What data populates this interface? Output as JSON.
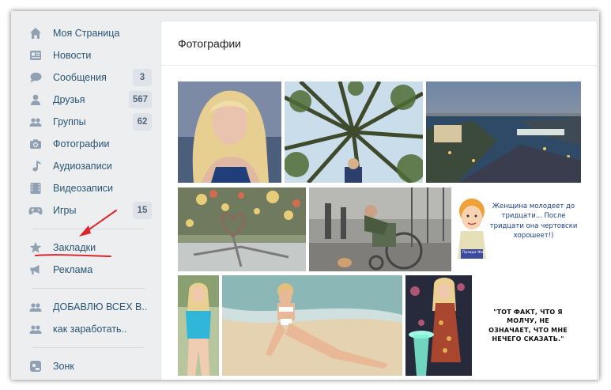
{
  "sidebar": {
    "items": [
      {
        "label": "Моя Страница",
        "icon": "home-icon"
      },
      {
        "label": "Новости",
        "icon": "news-icon"
      },
      {
        "label": "Сообщения",
        "icon": "messages-icon",
        "badge": "3"
      },
      {
        "label": "Друзья",
        "icon": "friends-icon",
        "badge": "567"
      },
      {
        "label": "Группы",
        "icon": "groups-icon",
        "badge": "62"
      },
      {
        "label": "Фотографии",
        "icon": "camera-icon"
      },
      {
        "label": "Аудиозаписи",
        "icon": "music-note-icon"
      },
      {
        "label": "Видеозаписи",
        "icon": "film-icon"
      },
      {
        "label": "Игры",
        "icon": "gamepad-icon",
        "badge": "15"
      },
      {
        "label": "Закладки",
        "icon": "star-icon"
      },
      {
        "label": "Реклама",
        "icon": "megaphone-icon"
      },
      {
        "label": "ДОБАВЛЮ ВСЕХ В..",
        "icon": "group-icon"
      },
      {
        "label": "как заработать..",
        "icon": "group-icon"
      },
      {
        "label": "Зонк",
        "icon": "app-icon"
      }
    ]
  },
  "main": {
    "title": "Фотографии",
    "photos": [
      {
        "subject": "blonde girl selfie"
      },
      {
        "subject": "forest canopy from below"
      },
      {
        "subject": "city river at dusk"
      },
      {
        "subject": "heart bokeh"
      },
      {
        "subject": "man in wheelchair"
      },
      {
        "subject": "cartoon girl with caption",
        "caption": "Женщина молодеет до тридцати... После тридцати она чертовски хорошеет!)",
        "brand": "Правда Жизни"
      },
      {
        "subject": "girl in blue top"
      },
      {
        "subject": "girl on beach"
      },
      {
        "subject": "girl in dress with glowing table"
      },
      {
        "subject": "quote card",
        "caption": "\"ТОТ ФАКТ, ЧТО Я МОЛЧУ, НЕ ОЗНАЧАЕТ, ЧТО МНЕ НЕЧЕГО СКАЗАТЬ.\""
      }
    ]
  },
  "colors": {
    "background": "#edeef0",
    "link": "#285473",
    "icon": "#8fa1b3",
    "badge": "#dfe3e9",
    "annotation": "#e0232b"
  }
}
